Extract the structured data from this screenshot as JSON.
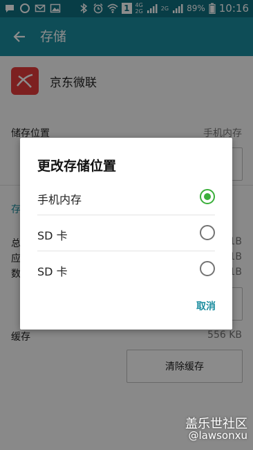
{
  "status_bar": {
    "network_badge": "1",
    "network_top": "4G",
    "network_bottom": "2G",
    "sim2_network": "2G",
    "battery_percent": "89%",
    "time": "10:16"
  },
  "app_bar": {
    "title": "存储"
  },
  "app": {
    "name": "京东微联"
  },
  "storage": {
    "location_label": "储存位置",
    "location_value": "手机内存",
    "section_prefix": "存",
    "total_prefix": "总",
    "app_prefix": "应",
    "data_prefix": "数",
    "total_suffix": "1B",
    "app_suffix": "1B",
    "data_suffix": "1B",
    "cache_label": "缓存",
    "cache_value": "556 KB",
    "clear_cache_button": "清除缓存"
  },
  "dialog": {
    "title": "更改存储位置",
    "options": [
      {
        "label": "手机内存",
        "selected": true
      },
      {
        "label": "SD 卡",
        "selected": false
      },
      {
        "label": "SD 卡",
        "selected": false
      }
    ],
    "cancel_label": "取消"
  },
  "watermark": {
    "line1": "盖乐世社区",
    "line2": "@lawsonxu"
  },
  "colors": {
    "status_bar": "#0f6f80",
    "app_bar": "#1a8c9e",
    "accent": "#1a8c9e",
    "radio_selected": "#3aaf3a",
    "app_icon": "#e33b3b"
  }
}
